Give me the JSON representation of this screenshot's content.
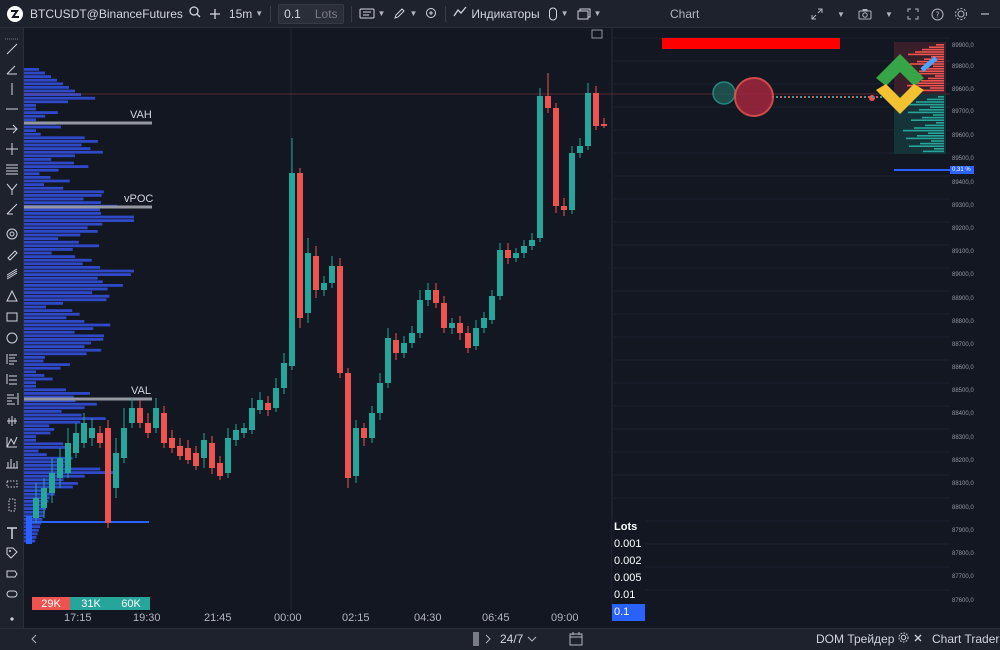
{
  "toolbar": {
    "symbol": "BTCUSDT@BinanceFutures",
    "interval": "15m",
    "quantity": "0.1",
    "quantity_unit": "Lots",
    "indicators_label": "Индикаторы"
  },
  "window": {
    "title": "Chart"
  },
  "levels": {
    "vah": "VAH",
    "vpoc": "vPOC",
    "val": "VAL"
  },
  "volume_badges": [
    "29K",
    "31K",
    "60K"
  ],
  "time_labels": [
    "17:15",
    "19:30",
    "21:45",
    "00:00",
    "02:15",
    "04:30",
    "06:45",
    "09:00"
  ],
  "lots_menu": {
    "header": "Lots",
    "options": [
      "0.001",
      "0.002",
      "0.005",
      "0.01",
      "0.1"
    ],
    "selected": "0.1"
  },
  "price_axis": [
    "89900,0",
    "89800,0",
    "89600,0",
    "89700,0",
    "89600,0",
    "89500,0",
    "89400,0",
    "89300,0",
    "89200,0",
    "89100,0",
    "89000,0",
    "88900,0",
    "88800,0",
    "88700,0",
    "88600,0",
    "88500,0",
    "88400,0",
    "88300,0",
    "88200,0",
    "88100,0",
    "88000,0",
    "87900,0",
    "87800,0",
    "87700,0",
    "87600,0"
  ],
  "price_tag": "0,31 %",
  "bottombar": {
    "session": "24/7",
    "dom_trader": "DOM Трейдер",
    "chart_trader": "Chart Trader"
  },
  "icons": [
    "chart-logo-icon",
    "search-icon",
    "compare-plus-icon",
    "chart-type-icon",
    "pencil-icon",
    "zoom-icon",
    "indicators-icon",
    "template-icon",
    "layout-icon",
    "fullscreen-icon",
    "camera-icon",
    "maximize-icon",
    "help-icon",
    "settings-icon",
    "minimize-icon",
    "calendar-icon",
    "close-icon",
    "gear-icon"
  ],
  "colors": {
    "up": "#26a69a",
    "down": "#ef5350",
    "profile": "#2f49c9",
    "accent": "#2962ff",
    "background": "#131722"
  }
}
